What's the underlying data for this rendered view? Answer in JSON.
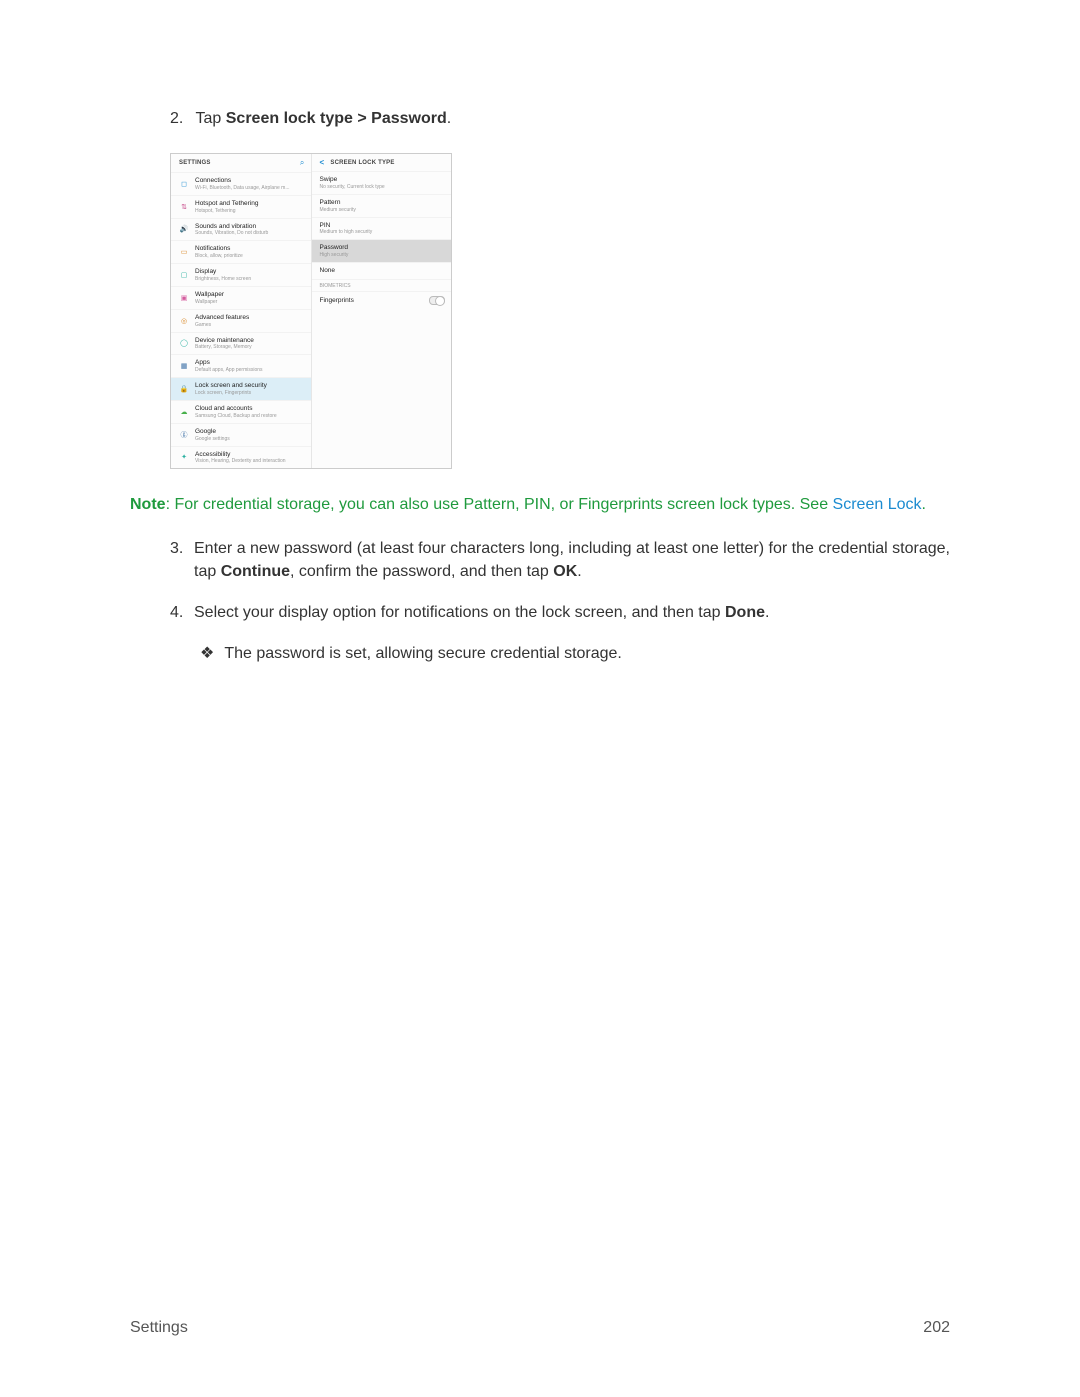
{
  "step2": {
    "number": "2.",
    "prefix": "Tap ",
    "bold": "Screen lock type > Password",
    "suffix": "."
  },
  "shot": {
    "left_header": "SETTINGS",
    "right_header": "SCREEN LOCK TYPE",
    "settings_rows": [
      {
        "title": "Connections",
        "sub": "Wi-Fi, Bluetooth, Data usage, Airplane m..."
      },
      {
        "title": "Hotspot and Tethering",
        "sub": "Hotspot, Tethering"
      },
      {
        "title": "Sounds and vibration",
        "sub": "Sounds, Vibration, Do not disturb"
      },
      {
        "title": "Notifications",
        "sub": "Block, allow, prioritize"
      },
      {
        "title": "Display",
        "sub": "Brightness, Home screen"
      },
      {
        "title": "Wallpaper",
        "sub": "Wallpaper"
      },
      {
        "title": "Advanced features",
        "sub": "Games"
      },
      {
        "title": "Device maintenance",
        "sub": "Battery, Storage, Memory"
      },
      {
        "title": "Apps",
        "sub": "Default apps, App permissions"
      },
      {
        "title": "Lock screen and security",
        "sub": "Lock screen, Fingerprints"
      },
      {
        "title": "Cloud and accounts",
        "sub": "Samsung Cloud, Backup and restore"
      },
      {
        "title": "Google",
        "sub": "Google settings"
      },
      {
        "title": "Accessibility",
        "sub": "Vision, Hearing, Dexterity and interaction"
      }
    ],
    "lock_rows": [
      {
        "title": "Swipe",
        "sub": "No security, Current lock type"
      },
      {
        "title": "Pattern",
        "sub": "Medium security"
      },
      {
        "title": "PIN",
        "sub": "Medium to high security"
      },
      {
        "title": "Password",
        "sub": "High security"
      },
      {
        "title": "None",
        "sub": ""
      }
    ],
    "biometrics_label": "BIOMETRICS",
    "fingerprints": "Fingerprints"
  },
  "note": {
    "label": "Note",
    "text": ": For credential storage, you can also use Pattern, PIN, or Fingerprints screen lock types. See ",
    "link": "Screen Lock",
    "suffix": "."
  },
  "step3": {
    "number": "3.",
    "p1": "Enter a new password (at least four characters long, including at least one letter) for the credential storage, tap ",
    "b1": "Continue",
    "p2": ", confirm the password, and then tap ",
    "b2": "OK",
    "p3": "."
  },
  "step4": {
    "number": "4.",
    "p1": "Select your display option for notifications on the lock screen, and then tap ",
    "b1": "Done",
    "p2": "."
  },
  "result": {
    "bullet": "❖",
    "text": "The password is set, allowing secure credential storage."
  },
  "footer": {
    "left": "Settings",
    "right": "202"
  }
}
